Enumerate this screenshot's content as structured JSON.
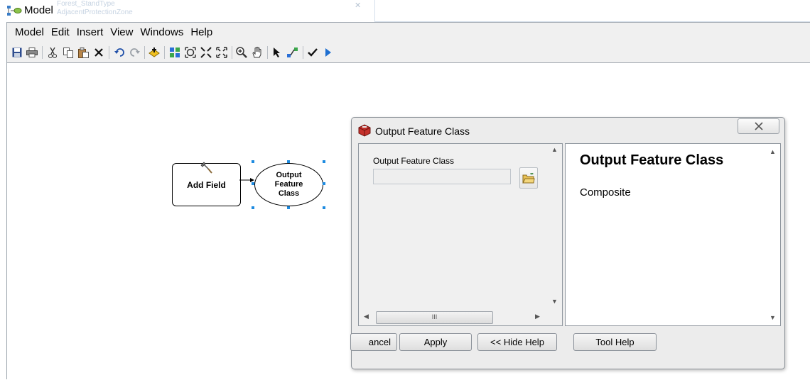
{
  "window": {
    "title": "Model"
  },
  "background_window": {
    "lines": [
      "Forest_StandType",
      "AdjacentProtectionZone"
    ]
  },
  "menu": [
    "Model",
    "Edit",
    "Insert",
    "View",
    "Windows",
    "Help"
  ],
  "toolbar": {
    "icons": [
      "save-icon",
      "print-icon",
      "cut-icon",
      "copy-icon",
      "paste-icon",
      "delete-icon",
      "undo-icon",
      "redo-icon",
      "add-data-icon",
      "auto-layout-icon",
      "full-extent-icon",
      "fixed-zoom-in-icon",
      "fixed-zoom-out-icon",
      "zoom-in-icon",
      "pan-icon",
      "select-icon",
      "connect-icon",
      "validate-icon",
      "run-icon"
    ]
  },
  "diagram": {
    "tool_node": "Add Field",
    "data_node_lines": [
      "Output",
      "Feature",
      "Class"
    ]
  },
  "dialog": {
    "title": "Output Feature Class",
    "param_label": "Output Feature Class",
    "param_value": "",
    "h_thumb_grip": "III",
    "help": {
      "title": "Output Feature Class",
      "text": "Composite"
    },
    "buttons": {
      "cancel": "ancel",
      "apply": "Apply",
      "hide_help": "<< Hide Help",
      "tool_help": "Tool Help"
    }
  },
  "colors": {
    "selection_handle": "#1e8be0",
    "run_arrow": "#1f6fd0",
    "dialog_icon": "#c4302b"
  }
}
